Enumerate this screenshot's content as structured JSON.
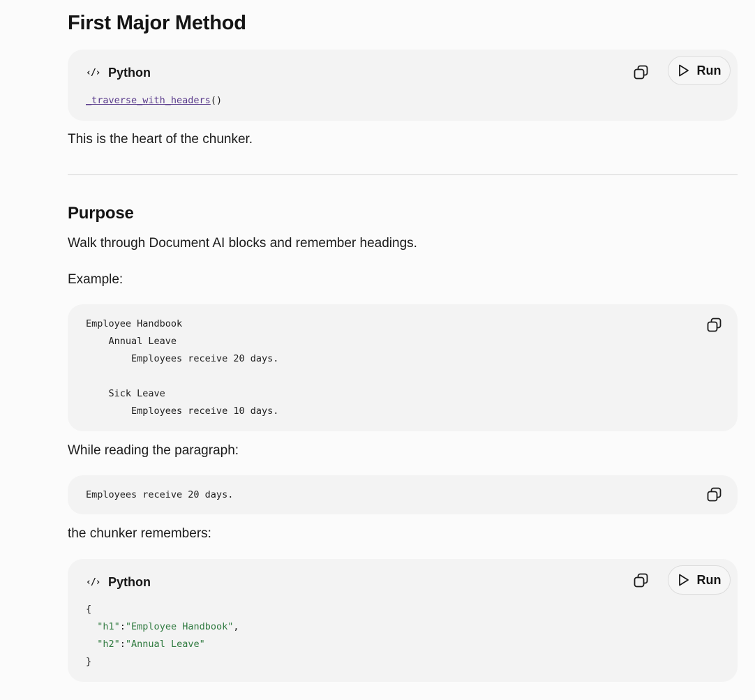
{
  "heading_first": "First Major Method",
  "block1": {
    "language": "Python",
    "run_label": "Run",
    "code_fn": "_traverse_with_headers",
    "code_parens": "()"
  },
  "para_heart": "This is the heart of the chunker.",
  "heading_purpose": "Purpose",
  "para_walk": "Walk through Document AI blocks and remember headings.",
  "para_example": "Example:",
  "block2": {
    "lines": [
      "Employee Handbook",
      "    Annual Leave",
      "        Employees receive 20 days.",
      "",
      "    Sick Leave",
      "        Employees receive 10 days."
    ]
  },
  "para_while": "While reading the paragraph:",
  "block3": {
    "line": "Employees receive 20 days."
  },
  "para_remembers": "the chunker remembers:",
  "block4": {
    "language": "Python",
    "run_label": "Run",
    "open_brace": "{",
    "close_brace": "}",
    "h1_key": "\"h1\"",
    "h1_val": "\"Employee Handbook\"",
    "h2_key": "\"h2\"",
    "h2_val": "\"Annual Leave\"",
    "colon": ":",
    "comma": ","
  }
}
